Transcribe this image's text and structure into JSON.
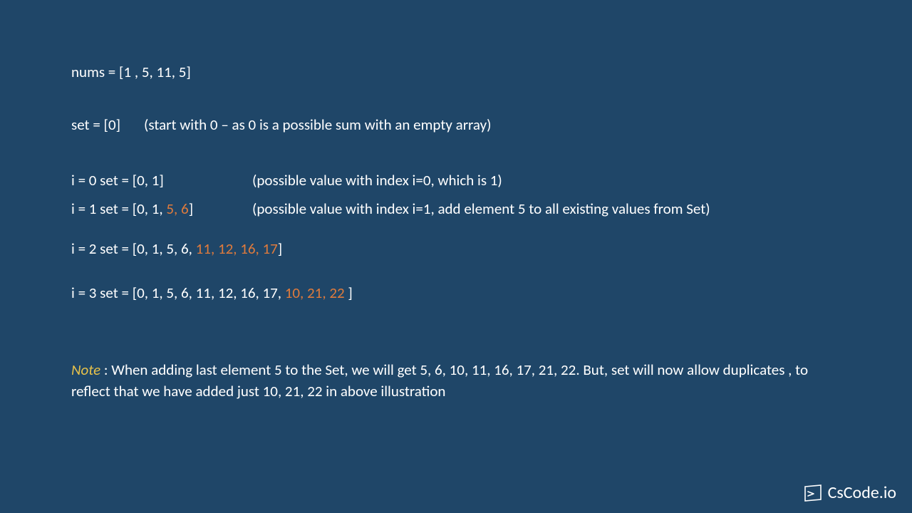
{
  "nums_line": "nums = [1 , 5, 11, 5]",
  "set_init_left": "set = [0]",
  "set_init_comment": "(start with 0 – as 0 is a possible sum with an empty array)",
  "iter0_left": "i = 0   set = [0, 1]",
  "iter0_comment": "(possible value with index i=0, which is 1)",
  "iter1_prefix": "i = 1  set = [0, 1, ",
  "iter1_highlight": "5, 6",
  "iter1_suffix": "]",
  "iter1_comment": "(possible value with index i=1, add element 5 to all existing values from Set)",
  "iter2_prefix": "i = 2  set = [0, 1, 5, 6, ",
  "iter2_highlight": "11, 12, 16, 17",
  "iter2_suffix": "]",
  "iter3_prefix": "i = 3  set = [0, 1, 5, 6, 11, 12, 16, 17, ",
  "iter3_highlight": "10, 21, 22 ",
  "iter3_suffix": "]",
  "note_label": "Note",
  "note_text": " : When adding last element 5 to the Set, we will get 5, 6, 10, 11, 16, 17, 21, 22. But, set will now allow duplicates , to reflect that we have added just 10, 21, 22 in above illustration",
  "logo_text": "CsCode.io"
}
